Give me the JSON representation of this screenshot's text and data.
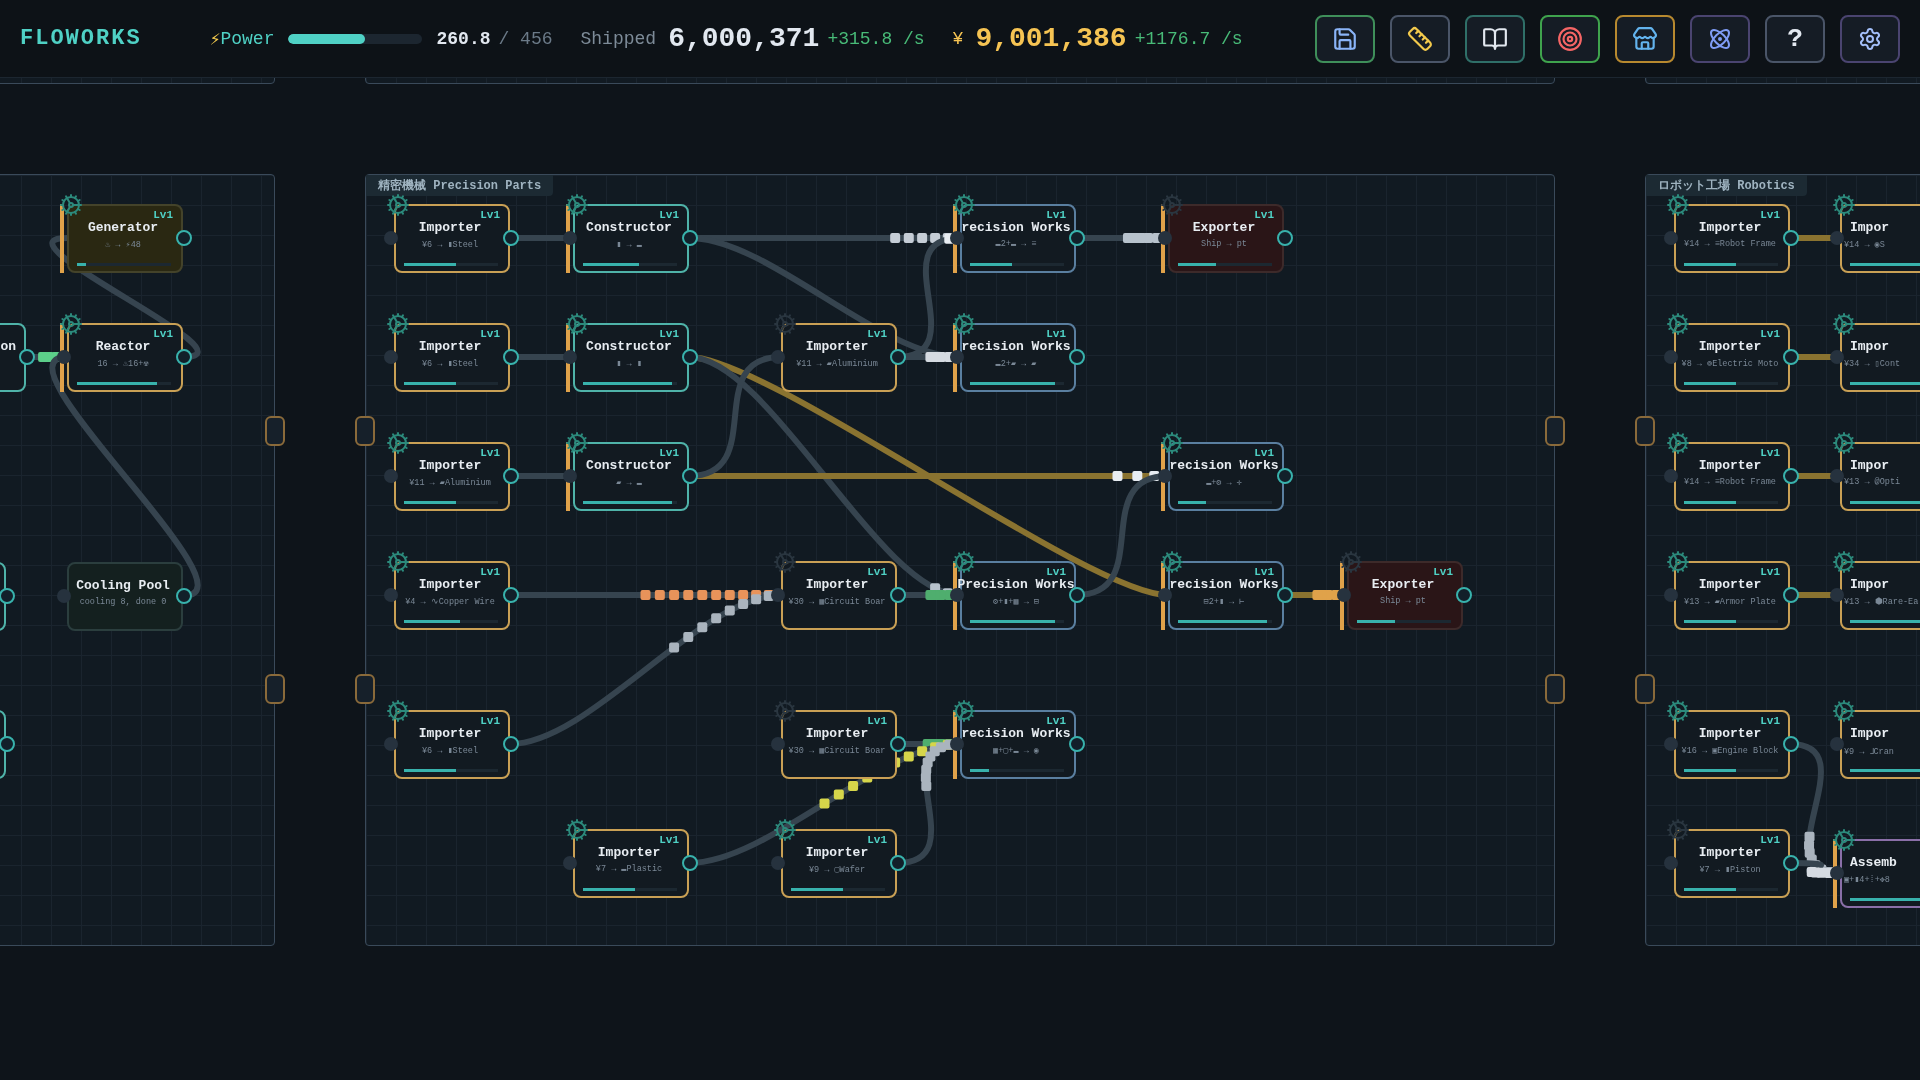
{
  "header": {
    "logo": "FLOWORKS",
    "power": {
      "icon": "⚡",
      "label": "Power",
      "level": 0.57,
      "value": "260.8",
      "max": "/ 456"
    },
    "shipped": {
      "label": "Shipped",
      "value": "6,000,371",
      "rate": "+315.8 /s"
    },
    "money": {
      "symbol": "¥",
      "value": "9,001,386",
      "rate": "+1176.7 /s"
    },
    "tools": [
      {
        "kind": "save",
        "color": "#3f8f5a"
      },
      {
        "kind": "ruler",
        "color": "#4a5568"
      },
      {
        "kind": "book",
        "color": "#2f6f68"
      },
      {
        "kind": "target",
        "color": "#3fa34d"
      },
      {
        "kind": "shop",
        "color": "#b7892f"
      },
      {
        "kind": "atom",
        "color": "#4a4470"
      },
      {
        "kind": "help",
        "label": "?",
        "color": "#4a5568"
      },
      {
        "kind": "settings",
        "color": "#4a4470"
      }
    ]
  },
  "panels": [
    {
      "nodes": [
        {
          "kind": "generator",
          "title": "Generator",
          "level_label": "Lv1",
          "recipe": "♨ → ⚡48",
          "level": 0.1,
          "active": true
        },
        {
          "kind": "stub",
          "title": "on"
        },
        {
          "kind": "reactor",
          "title": "Reactor",
          "level_label": "Lv1",
          "recipe": "16 → ♨16+☢",
          "level": 0.85,
          "active": true
        },
        {
          "kind": "stub"
        },
        {
          "kind": "cooling",
          "title": "Cooling Pool",
          "recipe": "cooling 8, done 0"
        },
        {
          "kind": "stub"
        }
      ]
    },
    {
      "title": "精密機械 Precision Parts",
      "nodes": [
        {
          "kind": "importer",
          "title": "Importer",
          "level_label": "Lv1",
          "recipe": "¥6 → ▮Steel",
          "level": 0.55,
          "active": true
        },
        {
          "kind": "constructor",
          "title": "Constructor",
          "level_label": "Lv1",
          "recipe": "▮ → ▬",
          "level": 0.6,
          "active": true
        },
        {
          "kind": "precision",
          "title": "recision Works",
          "level_label": "Lv1",
          "recipe": "▬2+▬ → ≡",
          "level": 0.45,
          "active": true
        },
        {
          "kind": "exporter",
          "title": "Exporter",
          "level_label": "Lv1",
          "recipe": "Ship → pt",
          "level": 0.4,
          "active": false
        },
        {
          "kind": "importer",
          "title": "Importer",
          "level_label": "Lv1",
          "recipe": "¥6 → ▮Steel",
          "level": 0.55,
          "active": true
        },
        {
          "kind": "constructor",
          "title": "Constructor",
          "level_label": "Lv1",
          "recipe": "▮ → ▮",
          "level": 0.95,
          "active": true
        },
        {
          "kind": "importer",
          "title": "Importer",
          "level_label": "Lv1",
          "recipe": "¥11 → ▰Aluminium",
          "active": false
        },
        {
          "kind": "precision",
          "title": "recision Works",
          "level_label": "Lv1",
          "recipe": "▬2+▰ → ▰",
          "level": 0.9,
          "active": true
        },
        {
          "kind": "importer",
          "title": "Importer",
          "level_label": "Lv1",
          "recipe": "¥11 → ▰Aluminium",
          "level": 0.55,
          "active": true
        },
        {
          "kind": "constructor",
          "title": "Constructor",
          "level_label": "Lv1",
          "recipe": "▰ → ▬",
          "level": 0.95,
          "active": true
        },
        {
          "kind": "precision",
          "title": "recision Works",
          "level_label": "Lv1",
          "recipe": "▬+⚙ → ✛",
          "level": 0.3,
          "active": true
        },
        {
          "kind": "importer",
          "title": "Importer",
          "level_label": "Lv1",
          "recipe": "¥4 → ∿Copper Wire",
          "level": 0.6,
          "active": true
        },
        {
          "kind": "importer",
          "title": "Importer",
          "level_label": "Lv1",
          "recipe": "¥30 → ▦Circuit Boar",
          "active": false
        },
        {
          "kind": "precision",
          "title": "Precision Works",
          "level_label": "Lv1",
          "recipe": "⚙+▮+▦ → ⊟",
          "level": 0.9,
          "active": true
        },
        {
          "kind": "precision",
          "title": "recision Works",
          "level_label": "Lv1",
          "recipe": "⊟2+▮ → ⊢",
          "level": 0.95,
          "active": true
        },
        {
          "kind": "exporter",
          "title": "Exporter",
          "level_label": "Lv1",
          "recipe": "Ship → pt",
          "level": 0.4,
          "active": false
        },
        {
          "kind": "importer",
          "title": "Importer",
          "level_label": "Lv1",
          "recipe": "¥6 → ▮Steel",
          "level": 0.55,
          "active": true
        },
        {
          "kind": "importer",
          "title": "Importer",
          "level_label": "Lv1",
          "recipe": "¥30 → ▦Circuit Boar",
          "active": false
        },
        {
          "kind": "precision",
          "title": "recision Works",
          "level_label": "Lv1",
          "recipe": "▦+▢+▬ → ◉",
          "level": 0.2,
          "active": true
        },
        {
          "kind": "importer",
          "title": "Importer",
          "level_label": "Lv1",
          "recipe": "¥7 → ▬Plastic",
          "level": 0.55,
          "active": true
        },
        {
          "kind": "importer",
          "title": "Importer",
          "level_label": "Lv1",
          "recipe": "¥9 → ▢Wafer",
          "level": 0.55,
          "active": true
        }
      ]
    },
    {
      "title": "ロボット工場 Robotics",
      "nodes": [
        {
          "kind": "importer",
          "title": "Importer",
          "level_label": "Lv1",
          "recipe": "¥14 → ≡Robot Frame",
          "level": 0.55,
          "active": true
        },
        {
          "kind": "importer",
          "title": "Impor",
          "recipe": "¥14 → ◉S",
          "level": 0.9,
          "active": true
        },
        {
          "kind": "importer",
          "title": "Importer",
          "level_label": "Lv1",
          "recipe": "¥8 → ⊚Electric Moto",
          "level": 0.55,
          "active": true
        },
        {
          "kind": "importer",
          "title": "Impor",
          "recipe": "¥34 → ▯Cont",
          "level": 0.9,
          "active": true
        },
        {
          "kind": "importer",
          "title": "Importer",
          "level_label": "Lv1",
          "recipe": "¥14 → ≡Robot Frame",
          "level": 0.55,
          "active": true
        },
        {
          "kind": "importer",
          "title": "Impor",
          "recipe": "¥13 → @Opti",
          "level": 0.9,
          "active": true
        },
        {
          "kind": "importer",
          "title": "Importer",
          "level_label": "Lv1",
          "recipe": "¥13 → ▰Armor Plate",
          "level": 0.55,
          "active": true
        },
        {
          "kind": "importer",
          "title": "Impor",
          "recipe": "¥13 → ⬢Rare-Ea",
          "level": 0.9,
          "active": true
        },
        {
          "kind": "importer",
          "title": "Importer",
          "level_label": "Lv1",
          "recipe": "¥16 → ▣Engine Block",
          "level": 0.55,
          "active": true
        },
        {
          "kind": "importer",
          "title": "Impor",
          "recipe": "¥9 → ⅃Cran",
          "level": 0.9,
          "active": true
        },
        {
          "kind": "importer",
          "title": "Importer",
          "level_label": "Lv1",
          "recipe": "¥7 → ▮Piston",
          "level": 0.55,
          "active": false
        },
        {
          "kind": "assembler",
          "title": "Assemb",
          "recipe": "▣+▮4+⁞+✥8",
          "level": 0.9,
          "active": true
        }
      ]
    }
  ]
}
